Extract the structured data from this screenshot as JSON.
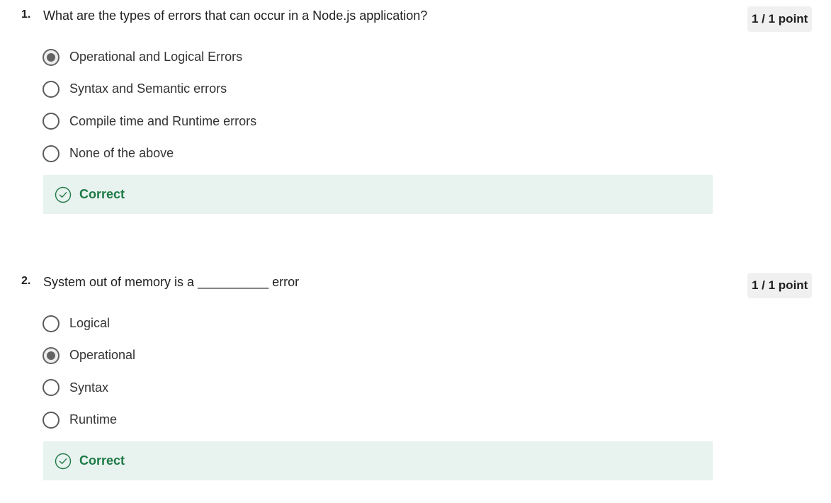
{
  "questions": [
    {
      "number": "1.",
      "text": "What are the types of errors that can occur in a Node.js application?",
      "points": "1 / 1 point",
      "options": [
        {
          "label": "Operational and Logical Errors",
          "selected": true
        },
        {
          "label": "Syntax and Semantic errors",
          "selected": false
        },
        {
          "label": "Compile time and Runtime errors",
          "selected": false
        },
        {
          "label": "None of the above",
          "selected": false
        }
      ],
      "feedback": "Correct"
    },
    {
      "number": "2.",
      "text": "System out of memory is a __________ error",
      "points": "1 / 1 point",
      "options": [
        {
          "label": "Logical",
          "selected": false
        },
        {
          "label": "Operational",
          "selected": true
        },
        {
          "label": "Syntax",
          "selected": false
        },
        {
          "label": "Runtime",
          "selected": false
        }
      ],
      "feedback": "Correct"
    }
  ],
  "colors": {
    "correct_text": "#1e7a46",
    "feedback_bg": "#e8f2ef",
    "points_badge_bg": "#f0f0f0"
  },
  "icons": {
    "feedback": "check-circle-icon"
  }
}
